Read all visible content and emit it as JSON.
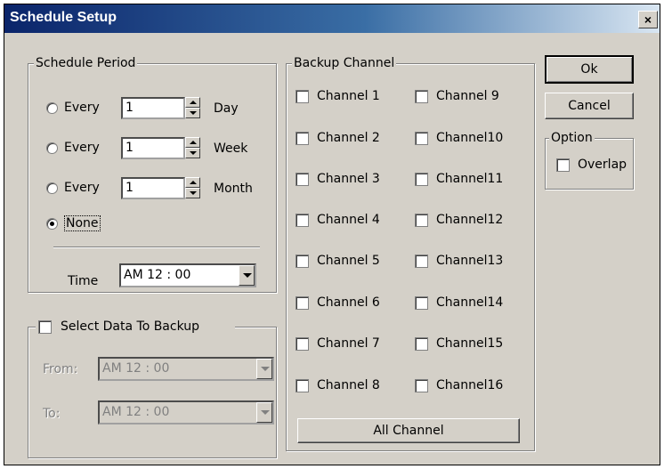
{
  "window": {
    "title": "Schedule Setup",
    "close_glyph": "×"
  },
  "schedule_period": {
    "legend": "Schedule Period",
    "rows": [
      {
        "label": "Every",
        "value": "1",
        "unit": "Day",
        "selected": false
      },
      {
        "label": "Every",
        "value": "1",
        "unit": "Week",
        "selected": false
      },
      {
        "label": "Every",
        "value": "1",
        "unit": "Month",
        "selected": false
      }
    ],
    "none_label": "None",
    "none_selected": true,
    "time_label": "Time",
    "time_value": "AM 12 : 00"
  },
  "select_data": {
    "legend": "Select Data To Backup",
    "checked": false,
    "from_label": "From:",
    "from_value": "AM 12 : 00",
    "to_label": "To:",
    "to_value": "AM 12 : 00"
  },
  "backup_channel": {
    "legend": "Backup Channel",
    "left": [
      "Channel 1",
      "Channel 2",
      "Channel 3",
      "Channel 4",
      "Channel 5",
      "Channel 6",
      "Channel 7",
      "Channel 8"
    ],
    "right": [
      "Channel 9",
      "Channel10",
      "Channel11",
      "Channel12",
      "Channel13",
      "Channel14",
      "Channel15",
      "Channel16"
    ],
    "all_button": "All Channel"
  },
  "buttons": {
    "ok": "Ok",
    "cancel": "Cancel"
  },
  "option": {
    "legend": "Option",
    "overlap_label": "Overlap",
    "overlap_checked": false
  }
}
